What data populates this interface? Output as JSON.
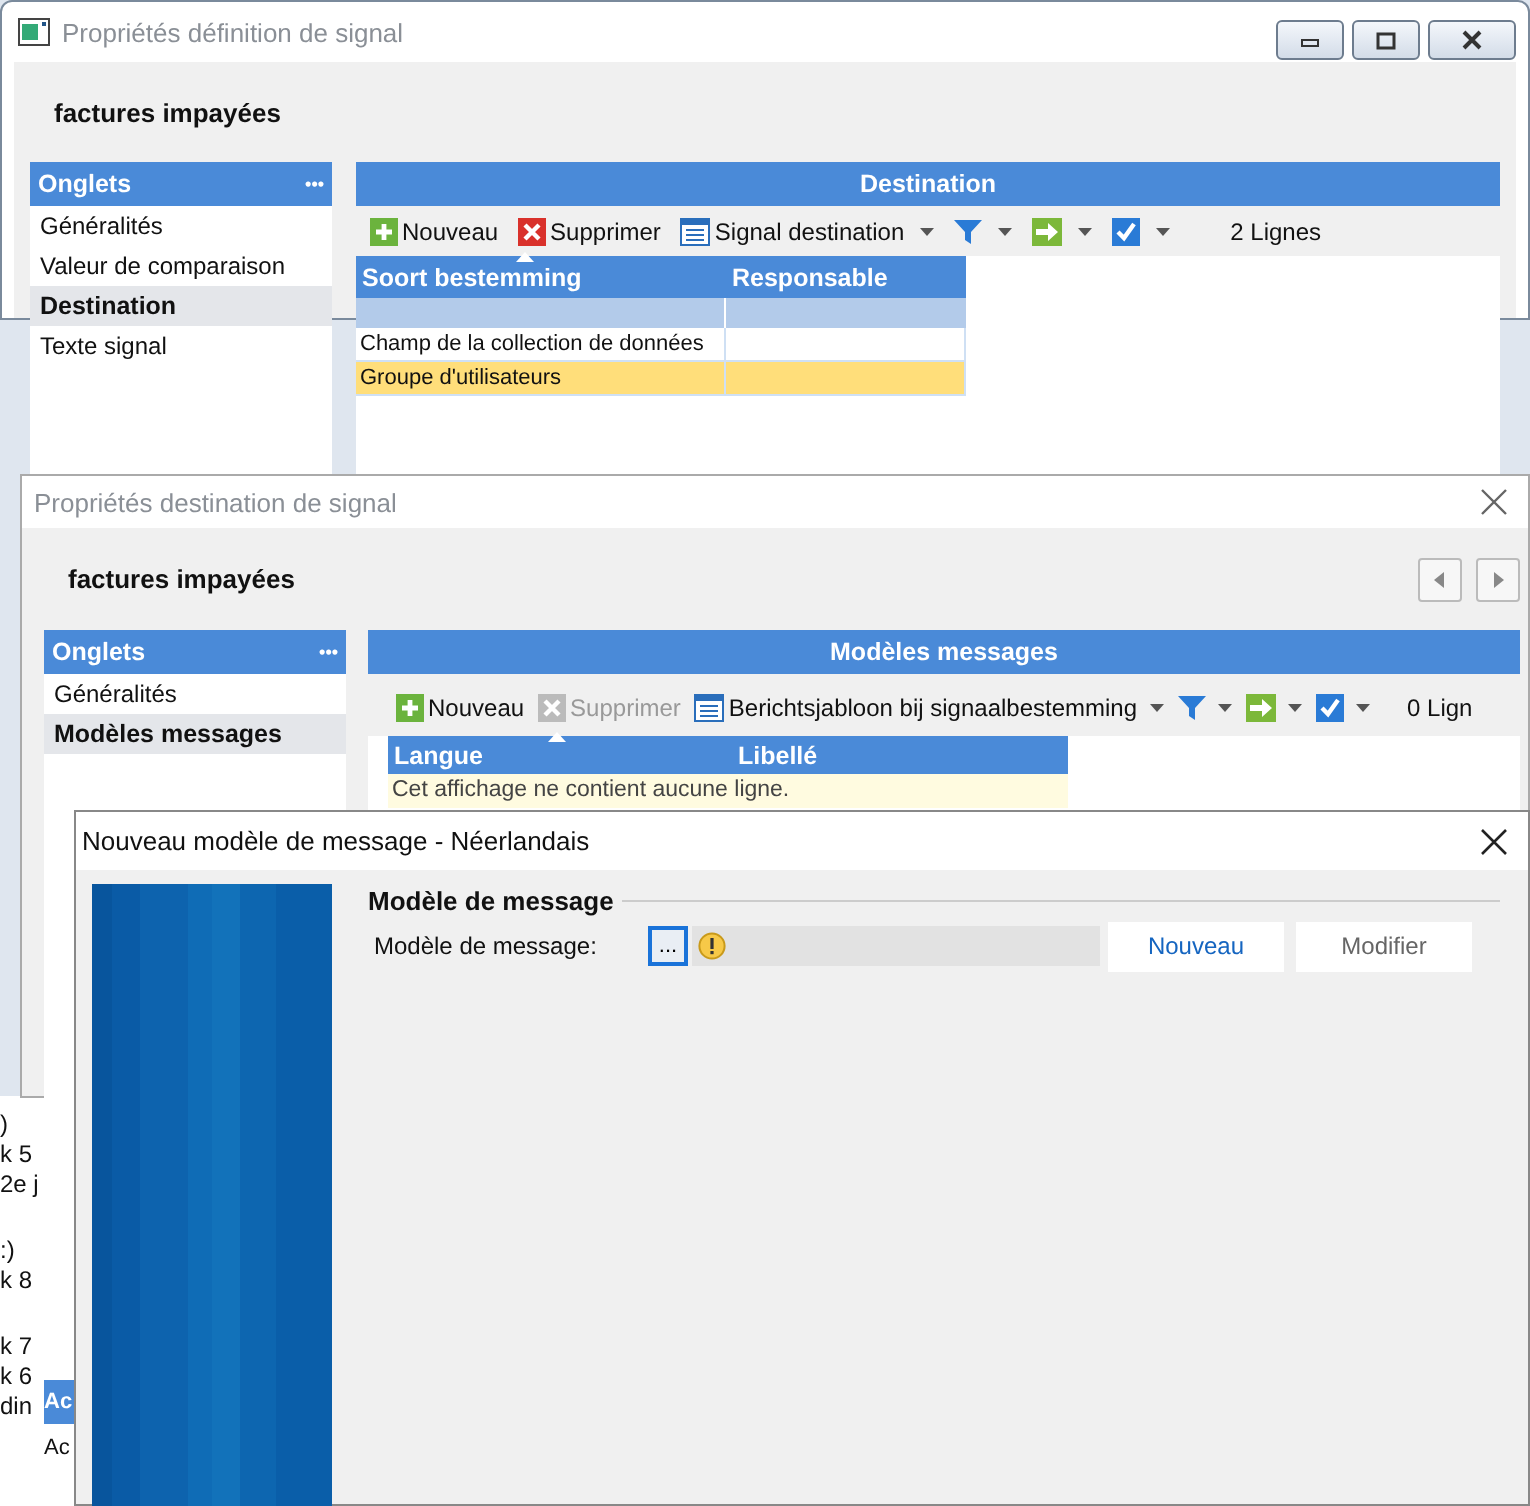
{
  "background": {
    "fragments": [
      ")",
      "k 5",
      "2e j",
      ":)",
      "k 8",
      "k 7",
      "k 6",
      "din"
    ],
    "header": "Ac",
    "item": "Ac"
  },
  "windows": [
    {
      "kind": "main",
      "title": "Propriétés définition de signal",
      "heading": "factures impayées",
      "sidebar": {
        "title": "Onglets",
        "more": "•••",
        "items": [
          {
            "label": "Généralités",
            "selected": false
          },
          {
            "label": "Valeur de comparaison",
            "selected": false
          },
          {
            "label": "Destination",
            "selected": true
          },
          {
            "label": "Texte signal",
            "selected": false
          }
        ]
      },
      "panel": {
        "title": "Destination",
        "toolbar": [
          {
            "kind": "new",
            "label": "Nouveau",
            "disabled": false
          },
          {
            "kind": "delete",
            "label": "Supprimer",
            "disabled": false
          },
          {
            "kind": "grid",
            "label": "Signal destination",
            "disabled": false
          },
          {
            "kind": "filter",
            "disabled": false
          },
          {
            "kind": "export",
            "disabled": false
          },
          {
            "kind": "check",
            "disabled": false
          }
        ],
        "count": "2 Lignes",
        "table": {
          "columns": [
            "Soort bestemming",
            "Responsable"
          ],
          "rows": [
            {
              "cells": [
                "Champ de la collection de données",
                ""
              ],
              "selected": false
            },
            {
              "cells": [
                "Groupe d'utilisateurs",
                ""
              ],
              "selected": true
            }
          ]
        }
      }
    },
    {
      "kind": "dialog",
      "title": "Propriétés destination de signal",
      "heading": "factures impayées",
      "sidebar": {
        "title": "Onglets",
        "more": "•••",
        "items": [
          {
            "label": "Généralités",
            "selected": false
          },
          {
            "label": "Modèles messages",
            "selected": true
          }
        ]
      },
      "panel": {
        "title": "Modèles messages",
        "toolbar": [
          {
            "kind": "new",
            "label": "Nouveau",
            "disabled": false
          },
          {
            "kind": "delete",
            "label": "Supprimer",
            "disabled": true
          },
          {
            "kind": "grid",
            "label": "Berichtsjabloon bij signaalbestemming",
            "disabled": false
          },
          {
            "kind": "filter",
            "disabled": false
          },
          {
            "kind": "export",
            "disabled": false
          },
          {
            "kind": "check",
            "disabled": false
          }
        ],
        "count": "0 Lign",
        "table": {
          "columns": [
            "Langue",
            "Libellé"
          ],
          "empty": "Cet affichage ne contient aucune ligne."
        }
      }
    }
  ],
  "dialog": {
    "title": "Nouveau modèle de message - Néerlandais",
    "section": "Modèle de message",
    "field_label": "Modèle de message:",
    "browse": "...",
    "buttons": [
      {
        "label": "Nouveau",
        "disabled": false
      },
      {
        "label": "Modifier",
        "disabled": true
      }
    ]
  }
}
